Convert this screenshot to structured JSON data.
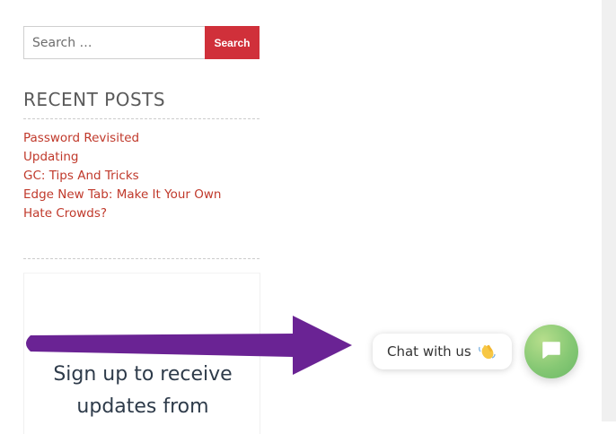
{
  "search": {
    "placeholder": "Search …",
    "button_label": "Search"
  },
  "recent_posts": {
    "title": "RECENT POSTS",
    "items": [
      {
        "label": "Password Revisited"
      },
      {
        "label": "Updating"
      },
      {
        "label": "GC: Tips And Tricks"
      },
      {
        "label": "Edge New Tab: Make It Your Own"
      },
      {
        "label": "Hate Crowds?"
      }
    ]
  },
  "signup": {
    "line1": "Sign up to receive",
    "line2": "updates from"
  },
  "chat": {
    "label": "Chat with us",
    "wave_icon": "waving-hand-icon",
    "fab_icon": "chat-message-icon"
  },
  "annotation": {
    "arrow_icon": "purple-arrow-icon",
    "arrow_color": "#6a2394"
  },
  "colors": {
    "accent_red": "#d0303a",
    "link_red": "#c0392b",
    "chat_green": "#86c874"
  }
}
